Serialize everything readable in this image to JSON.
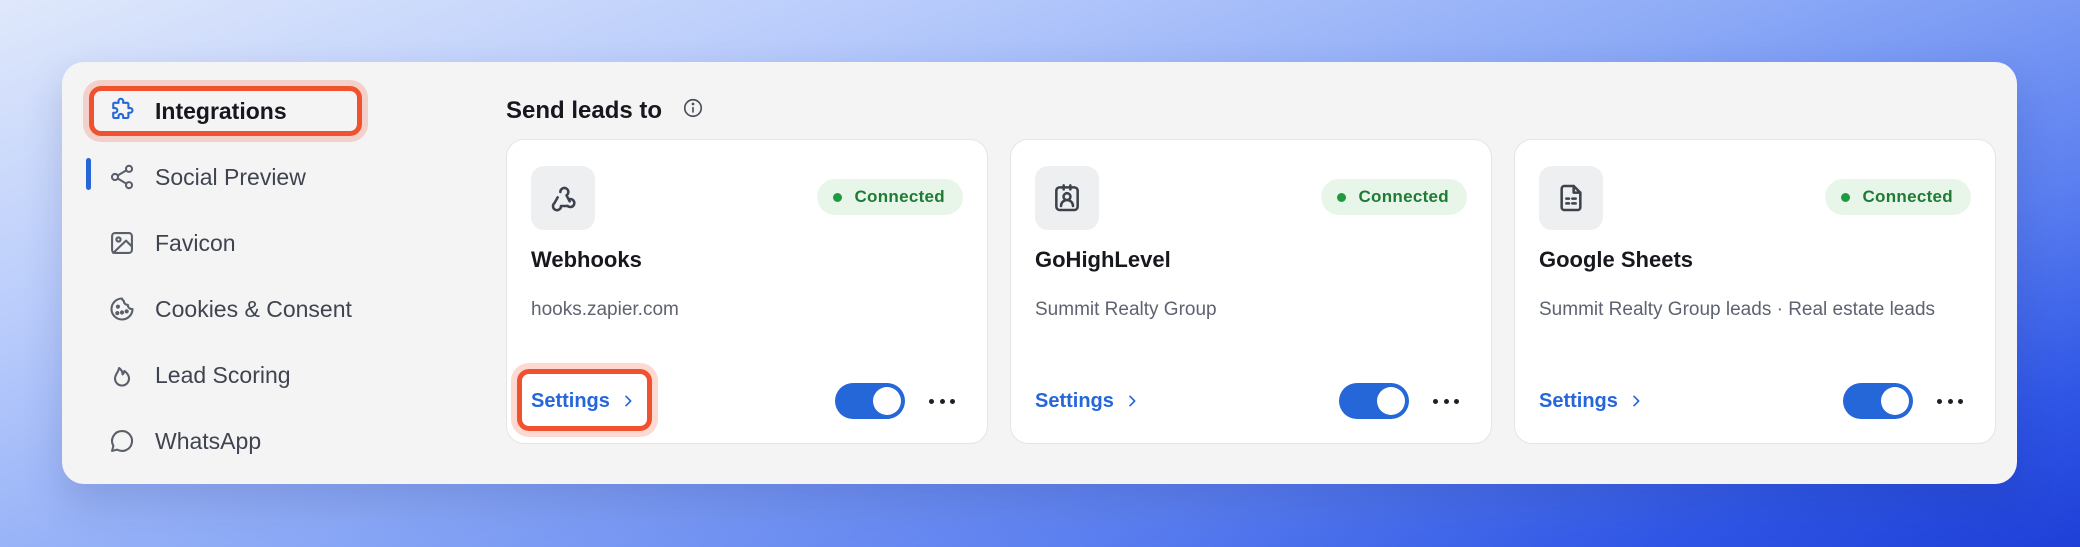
{
  "sidebar": {
    "items": [
      {
        "label": "Integrations",
        "icon": "puzzle-icon",
        "active": true
      },
      {
        "label": "Social Preview",
        "icon": "share-icon",
        "active": false
      },
      {
        "label": "Favicon",
        "icon": "image-icon",
        "active": false
      },
      {
        "label": "Cookies & Consent",
        "icon": "cookie-icon",
        "active": false
      },
      {
        "label": "Lead Scoring",
        "icon": "flame-icon",
        "active": false
      },
      {
        "label": "WhatsApp",
        "icon": "chat-bubble-icon",
        "active": false
      }
    ]
  },
  "main": {
    "title": "Send leads to",
    "title_icon": "info-icon",
    "cards": [
      {
        "name": "Webhooks",
        "icon": "webhook-icon",
        "status": "Connected",
        "description": "hooks.zapier.com",
        "settings_label": "Settings",
        "enabled": true
      },
      {
        "name": "GoHighLevel",
        "icon": "contact-badge-icon",
        "status": "Connected",
        "description": "Summit Realty Group",
        "settings_label": "Settings",
        "enabled": true
      },
      {
        "name": "Google Sheets",
        "icon": "sheet-document-icon",
        "status": "Connected",
        "description": "Summit Realty Group leads · Real estate leads",
        "settings_label": "Settings",
        "enabled": true
      }
    ]
  },
  "colors": {
    "accent": "#2566d8",
    "connected_bg": "#e8f6ea",
    "connected_text": "#1e7b34",
    "highlight": "#f0522f"
  }
}
